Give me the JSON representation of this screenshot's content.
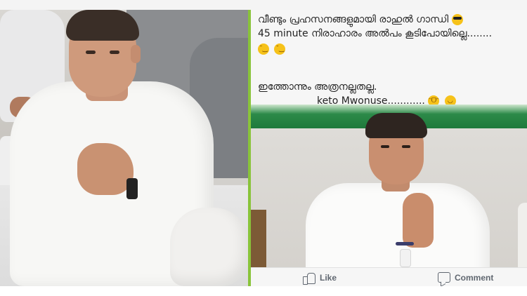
{
  "post": {
    "line_1": "വീണ്ടും പ്രഹസനങ്ങളുമായി രാഹുൽ ഗാന്ധി",
    "line_2": "45 minute നിരാഹാരം അൽപം കൂടിപോയില്ലെ........",
    "line_3": "ഇത്തോന്നും അത്രനല്ലതല്ല.",
    "line_4": "keto Mwonuse............",
    "emojis_line_1": [
      "sunglasses-emoji"
    ],
    "emojis_line_2": [
      "wink-emoji",
      "wink-emoji"
    ],
    "emojis_line_4": [
      "tears-of-joy-emoji",
      "smile-emoji"
    ]
  },
  "actions": {
    "like_label": "Like",
    "comment_label": "Comment"
  },
  "colors": {
    "divider": "#89c43a",
    "banner_green": "#2c8a48",
    "action_text": "#606770"
  }
}
